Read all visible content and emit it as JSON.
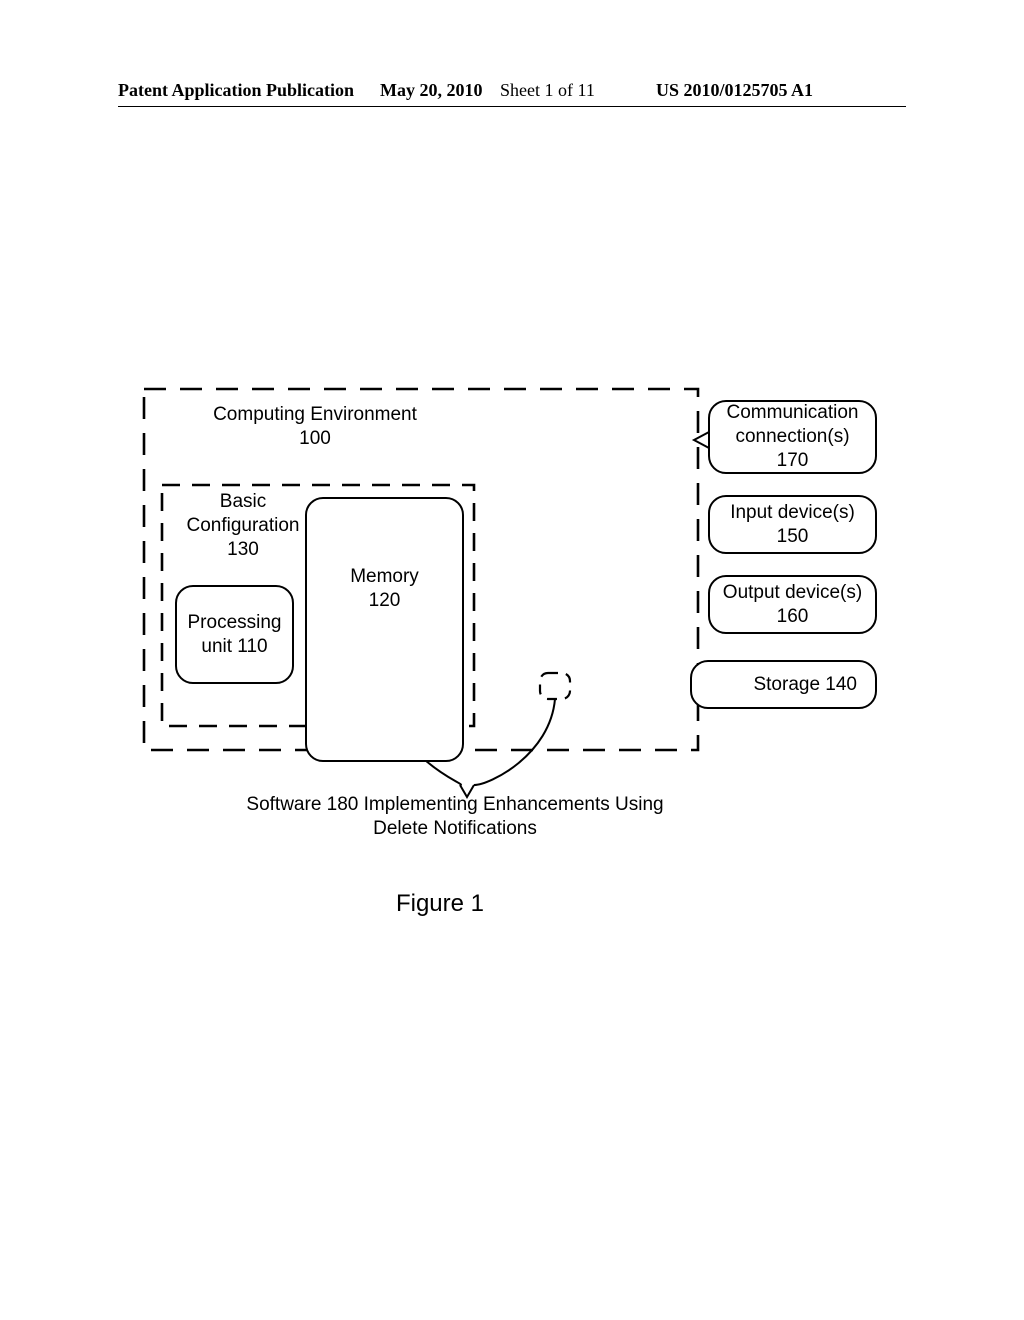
{
  "header": {
    "left": "Patent Application Publication",
    "date": "May 20, 2010",
    "sheet": "Sheet 1 of 11",
    "pubno": "US 2010/0125705 A1"
  },
  "env": {
    "title_line1": "Computing Environment",
    "title_ref": "100"
  },
  "basic": {
    "title_line1": "Basic",
    "title_line2": "Configuration",
    "title_ref": "130"
  },
  "proc": {
    "line1": "Processing",
    "line2": "unit 110"
  },
  "mem": {
    "line1": "Memory",
    "line2": "120"
  },
  "comm": {
    "line1": "Communication",
    "line2": "connection(s)",
    "line3": "170"
  },
  "input": {
    "line1": "Input device(s)",
    "line2": "150"
  },
  "output": {
    "line1": "Output device(s)",
    "line2": "160"
  },
  "storage": {
    "line1": "Storage 140"
  },
  "software": {
    "line1": "Software 180 Implementing Enhancements Using",
    "line2": "Delete Notifications"
  },
  "figure_caption": "Figure 1"
}
